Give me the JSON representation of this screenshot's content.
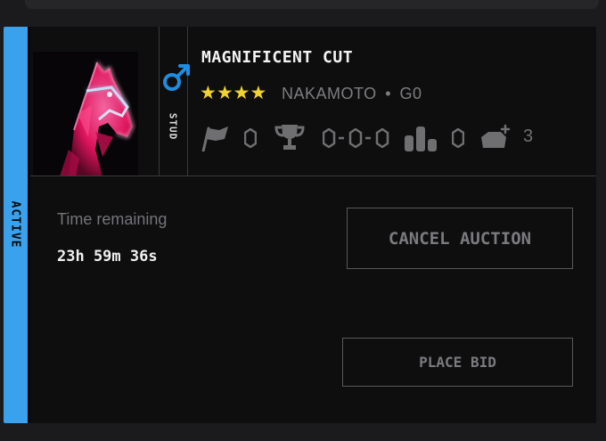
{
  "listing": {
    "status": "ACTIVE",
    "horse": {
      "name": "MAGNIFICENT CUT",
      "type_label": "STUD",
      "gender_icon": "male-symbol-icon",
      "rating_stars": 4,
      "bloodline": "NAKAMOTO",
      "separator": "•",
      "generation": "G0",
      "stats": {
        "races": "0",
        "record": "0-0-0",
        "rank": "0",
        "offspring": "3"
      }
    },
    "auction": {
      "time_label": "Time remaining",
      "time_value": "23h 59m 36s",
      "cancel_label": "CANCEL AUCTION",
      "bid_label": "PLACE BID"
    }
  },
  "colors": {
    "status_accent": "#3aa2ec",
    "star": "#f1d22f",
    "horse_glow": "#ff2d7a",
    "gender": "#1e8de0"
  }
}
